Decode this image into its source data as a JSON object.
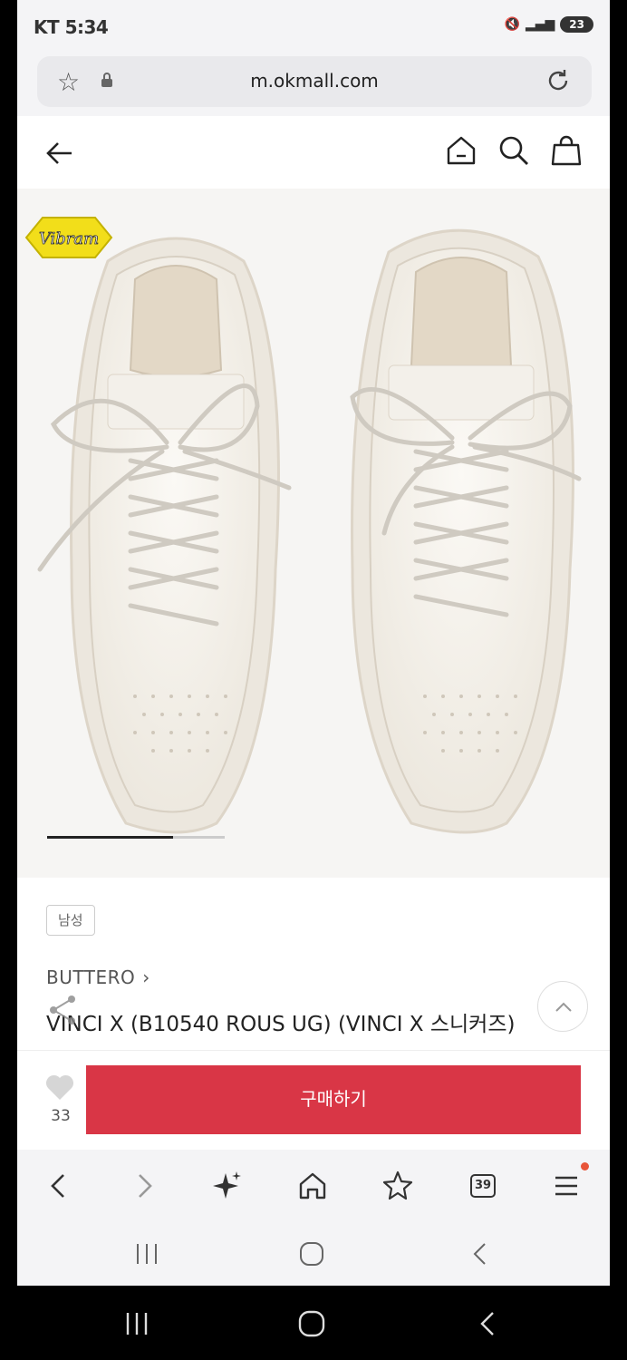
{
  "status": {
    "time": "KT 5:34",
    "battery": "23"
  },
  "browser": {
    "url": "m.okmall.com",
    "tab_count": "39"
  },
  "product": {
    "image_logo": "Vibram",
    "gender_tag": "남성",
    "brand": "BUTTERO",
    "name": "VINCI X (B10540 ROUS UG) (VINCI X 스니커즈)",
    "likes": "33",
    "buy_label": "구매하기",
    "carousel_progress": 0.71
  },
  "colors": {
    "buy_button": "#d93646",
    "notification_dot": "#e8553a"
  }
}
